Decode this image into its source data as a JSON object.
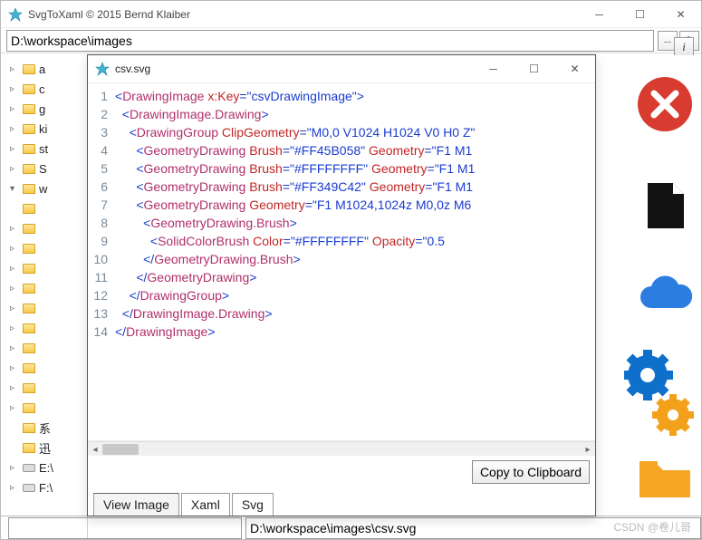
{
  "main": {
    "title": "SvgToXaml  © 2015 Bernd Klaiber",
    "path_value": "D:\\workspace\\images",
    "info_label": "i",
    "browse_label": "...",
    "selected_file": "D:\\workspace\\images\\csv.svg"
  },
  "tree": {
    "items": [
      {
        "label": "a",
        "twisty": "▹",
        "kind": "folder"
      },
      {
        "label": "c",
        "twisty": "▹",
        "kind": "folder"
      },
      {
        "label": "g",
        "twisty": "▹",
        "kind": "folder"
      },
      {
        "label": "ki",
        "twisty": "▹",
        "kind": "folder"
      },
      {
        "label": "st",
        "twisty": "▹",
        "kind": "folder"
      },
      {
        "label": "S",
        "twisty": "▹",
        "kind": "folder"
      },
      {
        "label": "w",
        "twisty": "▾",
        "kind": "folder"
      },
      {
        "label": "",
        "twisty": "",
        "kind": "folder"
      },
      {
        "label": "",
        "twisty": "▹",
        "kind": "folder"
      },
      {
        "label": "",
        "twisty": "▹",
        "kind": "folder"
      },
      {
        "label": "",
        "twisty": "▹",
        "kind": "folder"
      },
      {
        "label": "",
        "twisty": "▹",
        "kind": "folder"
      },
      {
        "label": "",
        "twisty": "▹",
        "kind": "folder"
      },
      {
        "label": "",
        "twisty": "▹",
        "kind": "folder"
      },
      {
        "label": "",
        "twisty": "▹",
        "kind": "folder"
      },
      {
        "label": "",
        "twisty": "▹",
        "kind": "folder"
      },
      {
        "label": "",
        "twisty": "▹",
        "kind": "folder"
      },
      {
        "label": "",
        "twisty": "▹",
        "kind": "folder"
      },
      {
        "label": "系",
        "twisty": "",
        "kind": "folder"
      },
      {
        "label": "迅",
        "twisty": "",
        "kind": "folder"
      },
      {
        "label": "E:\\",
        "twisty": "▹",
        "kind": "drive"
      },
      {
        "label": "F:\\",
        "twisty": "▹",
        "kind": "drive"
      }
    ]
  },
  "child": {
    "title": "csv.svg",
    "tabs": [
      "View Image",
      "Xaml",
      "Svg"
    ],
    "active_tab": 0,
    "copy_label": "Copy to Clipboard",
    "code": [
      {
        "n": 1,
        "html": "<span class='punct'>&lt;</span><span class='tag'>DrawingImage</span> <span class='attr'>x:Key</span><span class='punct'>=</span><span class='val'>\"csvDrawingImage\"</span><span class='punct'>&gt;</span>"
      },
      {
        "n": 2,
        "html": "&nbsp;&nbsp;<span class='punct'>&lt;</span><span class='tag'>DrawingImage.Drawing</span><span class='punct'>&gt;</span>"
      },
      {
        "n": 3,
        "html": "&nbsp;&nbsp;&nbsp;&nbsp;<span class='punct'>&lt;</span><span class='tag'>DrawingGroup</span> <span class='attr'>ClipGeometry</span><span class='punct'>=</span><span class='val'>\"M0,0 V1024 H1024 V0 H0 Z\"</span>"
      },
      {
        "n": 4,
        "html": "&nbsp;&nbsp;&nbsp;&nbsp;&nbsp;&nbsp;<span class='punct'>&lt;</span><span class='tag'>GeometryDrawing</span> <span class='attr'>Brush</span><span class='punct'>=</span><span class='val'>\"#FF45B058\"</span> <span class='attr'>Geometry</span><span class='punct'>=</span><span class='val'>\"F1 M1</span>"
      },
      {
        "n": 5,
        "html": "&nbsp;&nbsp;&nbsp;&nbsp;&nbsp;&nbsp;<span class='punct'>&lt;</span><span class='tag'>GeometryDrawing</span> <span class='attr'>Brush</span><span class='punct'>=</span><span class='val'>\"#FFFFFFFF\"</span> <span class='attr'>Geometry</span><span class='punct'>=</span><span class='val'>\"F1 M1</span>"
      },
      {
        "n": 6,
        "html": "&nbsp;&nbsp;&nbsp;&nbsp;&nbsp;&nbsp;<span class='punct'>&lt;</span><span class='tag'>GeometryDrawing</span> <span class='attr'>Brush</span><span class='punct'>=</span><span class='val'>\"#FF349C42\"</span> <span class='attr'>Geometry</span><span class='punct'>=</span><span class='val'>\"F1 M1</span>"
      },
      {
        "n": 7,
        "html": "&nbsp;&nbsp;&nbsp;&nbsp;&nbsp;&nbsp;<span class='punct'>&lt;</span><span class='tag'>GeometryDrawing</span> <span class='attr'>Geometry</span><span class='punct'>=</span><span class='val'>\"F1 M1024,1024z M0,0z M6</span>"
      },
      {
        "n": 8,
        "html": "&nbsp;&nbsp;&nbsp;&nbsp;&nbsp;&nbsp;&nbsp;&nbsp;<span class='punct'>&lt;</span><span class='tag'>GeometryDrawing.Brush</span><span class='punct'>&gt;</span>"
      },
      {
        "n": 9,
        "html": "&nbsp;&nbsp;&nbsp;&nbsp;&nbsp;&nbsp;&nbsp;&nbsp;&nbsp;&nbsp;<span class='punct'>&lt;</span><span class='tag'>SolidColorBrush</span> <span class='attr'>Color</span><span class='punct'>=</span><span class='val'>\"#FFFFFFFF\"</span> <span class='attr'>Opacity</span><span class='punct'>=</span><span class='val'>\"0.5</span>"
      },
      {
        "n": 10,
        "html": "&nbsp;&nbsp;&nbsp;&nbsp;&nbsp;&nbsp;&nbsp;&nbsp;<span class='punct'>&lt;/</span><span class='tag'>GeometryDrawing.Brush</span><span class='punct'>&gt;</span>"
      },
      {
        "n": 11,
        "html": "&nbsp;&nbsp;&nbsp;&nbsp;&nbsp;&nbsp;<span class='punct'>&lt;/</span><span class='tag'>GeometryDrawing</span><span class='punct'>&gt;</span>"
      },
      {
        "n": 12,
        "html": "&nbsp;&nbsp;&nbsp;&nbsp;<span class='punct'>&lt;/</span><span class='tag'>DrawingGroup</span><span class='punct'>&gt;</span>"
      },
      {
        "n": 13,
        "html": "&nbsp;&nbsp;<span class='punct'>&lt;/</span><span class='tag'>DrawingImage.Drawing</span><span class='punct'>&gt;</span>"
      },
      {
        "n": 14,
        "html": "<span class='punct'>&lt;/</span><span class='tag'>DrawingImage</span><span class='punct'>&gt;</span>"
      }
    ]
  },
  "watermark": "CSDN @卷儿哥"
}
